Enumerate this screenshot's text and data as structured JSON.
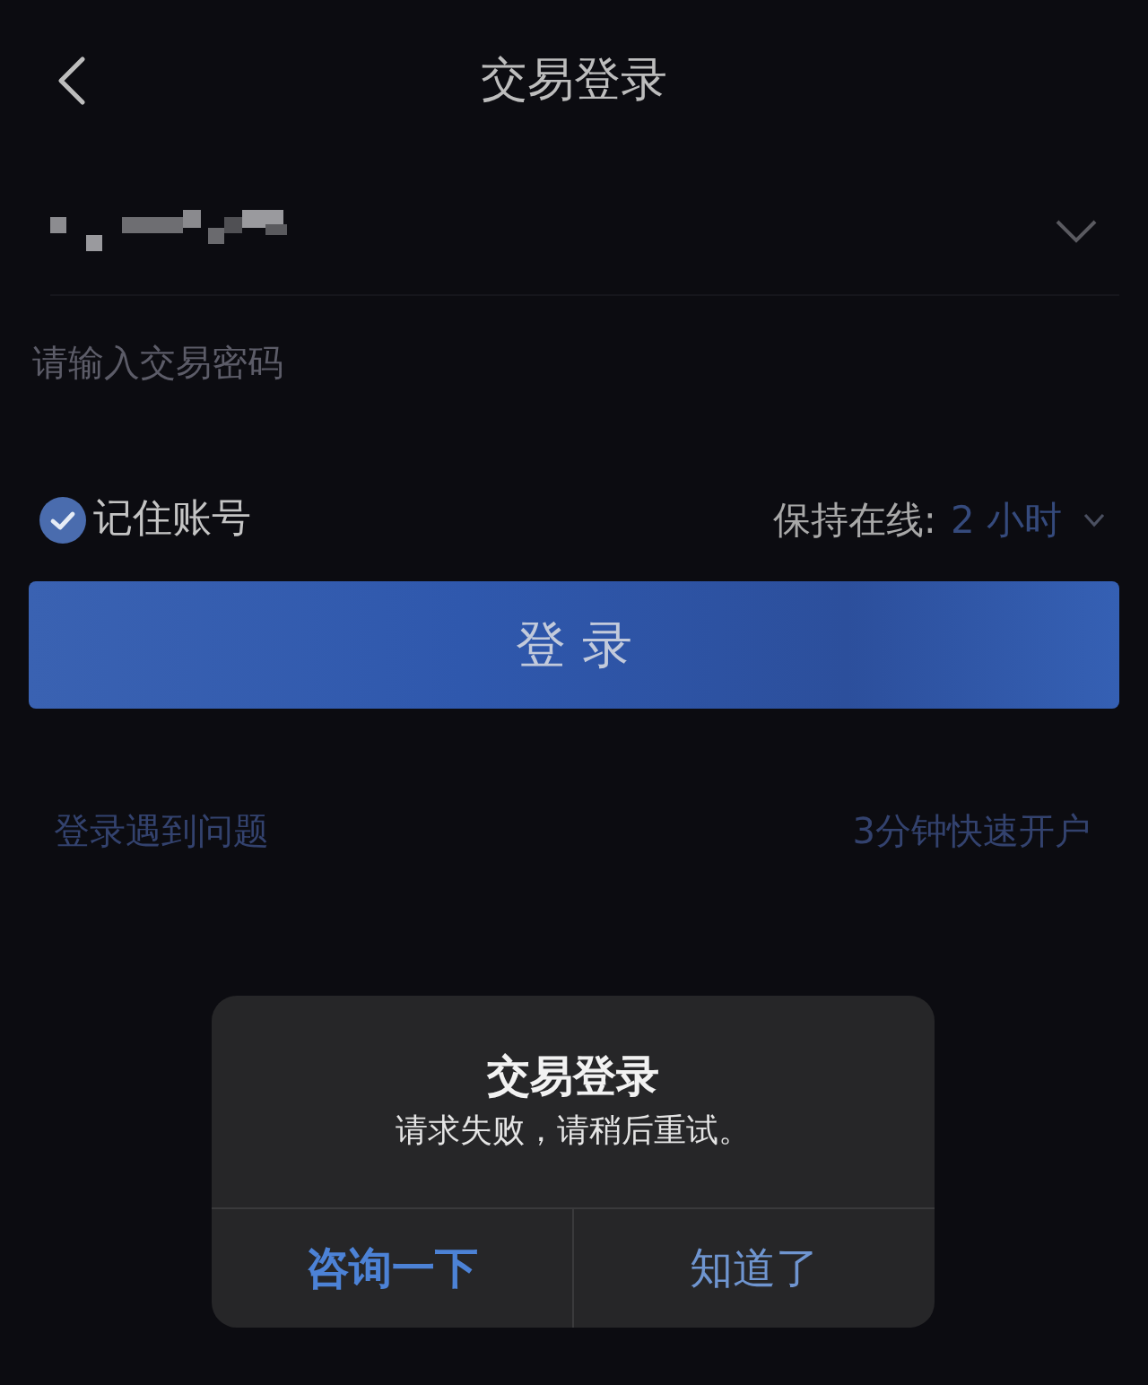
{
  "header": {
    "title": "交易登录"
  },
  "password_field": {
    "placeholder": "请输入交易密码"
  },
  "remember": {
    "label": "记住账号",
    "checked": true
  },
  "keep_online": {
    "label": "保持在线:",
    "value": "2 小时"
  },
  "login_button": {
    "label": "登 录"
  },
  "links": [
    {
      "label": "登录遇到问题"
    },
    {
      "label": "3分钟快速开户"
    }
  ],
  "dialog": {
    "title": "交易登录",
    "message": "请求失败，请稍后重试。",
    "buttons": [
      {
        "label": "咨询一下",
        "kind": "primary"
      },
      {
        "label": "知道了",
        "kind": "default"
      }
    ]
  }
}
